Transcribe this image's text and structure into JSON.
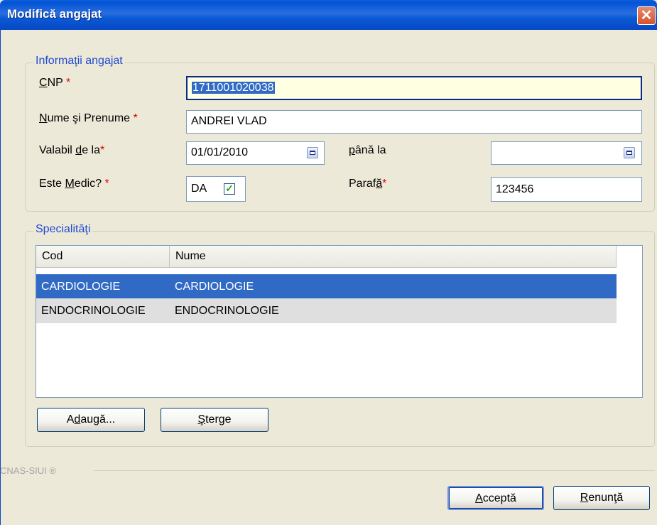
{
  "window": {
    "title": "Modifică angajat",
    "close_glyph": "✕"
  },
  "employee_info": {
    "legend": "Informaţii angajat",
    "cnp": {
      "label_pre": "",
      "label_key": "C",
      "label_post": "NP",
      "required": "*",
      "value": "1711001020038"
    },
    "name": {
      "label_pre": "",
      "label_key": "N",
      "label_post": "ume şi Prenume",
      "required": "*",
      "value": "ANDREI VLAD"
    },
    "valid_from": {
      "label_pre": "Valabil ",
      "label_key": "d",
      "label_post": "e la",
      "required": "*",
      "value": "01/01/2010"
    },
    "valid_to": {
      "label_pre": "",
      "label_key": "p",
      "label_post": "ână la",
      "value": ""
    },
    "is_doctor": {
      "label_pre": "Este ",
      "label_key": "M",
      "label_post": "edic?",
      "required": "*",
      "value_text": "DA",
      "checked": true,
      "check_glyph": "✓"
    },
    "parafa": {
      "label_pre": "Paraf",
      "label_key": "ă",
      "label_post": "",
      "required": "*",
      "value": "123456"
    }
  },
  "specialties": {
    "legend": "Specialităţi",
    "columns": [
      "Cod",
      "Nume"
    ],
    "rows": [
      {
        "cod": "CARDIOLOGIE",
        "nume": "CARDIOLOGIE",
        "selected": true
      },
      {
        "cod": "ENDOCRINOLOGIE",
        "nume": "ENDOCRINOLOGIE",
        "selected": false
      }
    ],
    "add_button": {
      "pre": "A",
      "key": "d",
      "post": "augă..."
    },
    "delete_button": {
      "pre": "",
      "key": "Ş",
      "post": "terge"
    }
  },
  "footer": {
    "brand": "CNAS-SIUI ®",
    "accept_button": {
      "pre": "",
      "key": "A",
      "post": "cceptă"
    },
    "cancel_button": {
      "pre": "",
      "key": "R",
      "post": "enunţă"
    }
  },
  "colors": {
    "titlebar": "#0453d6",
    "selection": "#316ac5",
    "legend_text": "#1f4bd2",
    "required": "#e00000",
    "focused_input_bg": "#ffffe1"
  }
}
